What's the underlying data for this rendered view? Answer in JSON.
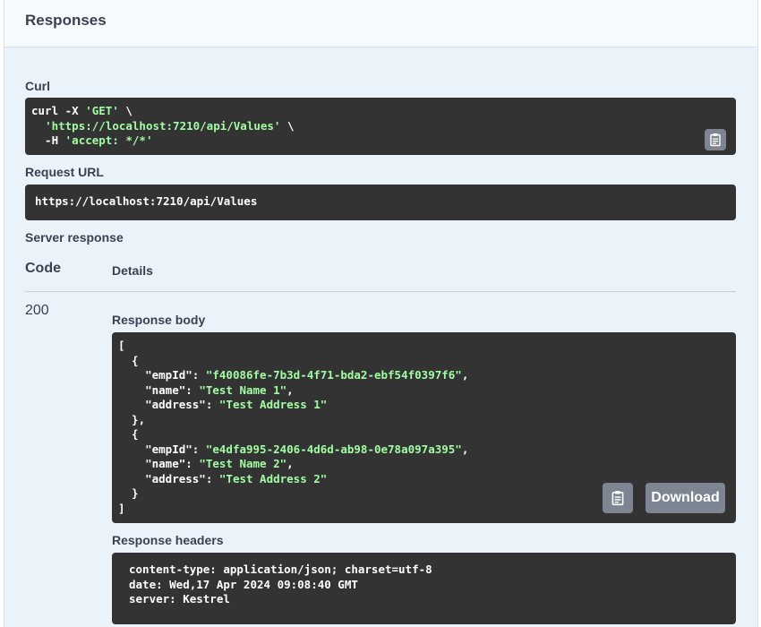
{
  "section": {
    "title": "Responses"
  },
  "curl": {
    "label": "Curl",
    "line1_prefix": "curl -X ",
    "line1_method": "'GET'",
    "line1_suffix": " \\",
    "line2_indent": "  ",
    "line2_url": "'https://localhost:7210/api/Values'",
    "line2_suffix": " \\",
    "line3_prefix": "  -H ",
    "line3_header": "'accept: */*'"
  },
  "request_url": {
    "label": "Request URL",
    "value": "https://localhost:7210/api/Values"
  },
  "server_response": {
    "label": "Server response",
    "code_header": "Code",
    "details_header": "Details",
    "status_code": "200"
  },
  "response_body": {
    "label": "Response body",
    "items": [
      {
        "empId": "\"f40086fe-7b3d-4f71-bda2-ebf54f0397f6\"",
        "name": "\"Test Name 1\"",
        "address": "\"Test Address 1\""
      },
      {
        "empId": "\"e4dfa995-2406-4d6d-ab98-0e78a097a395\"",
        "name": "\"Test Name 2\"",
        "address": "\"Test Address 2\""
      }
    ],
    "download_label": "Download"
  },
  "response_headers": {
    "label": "Response headers",
    "lines": [
      "content-type: application/json; charset=utf-8",
      "date: Wed,17 Apr 2024 09:08:40 GMT",
      "server: Kestrel"
    ]
  },
  "icons": {
    "copy": "clipboard-icon"
  }
}
